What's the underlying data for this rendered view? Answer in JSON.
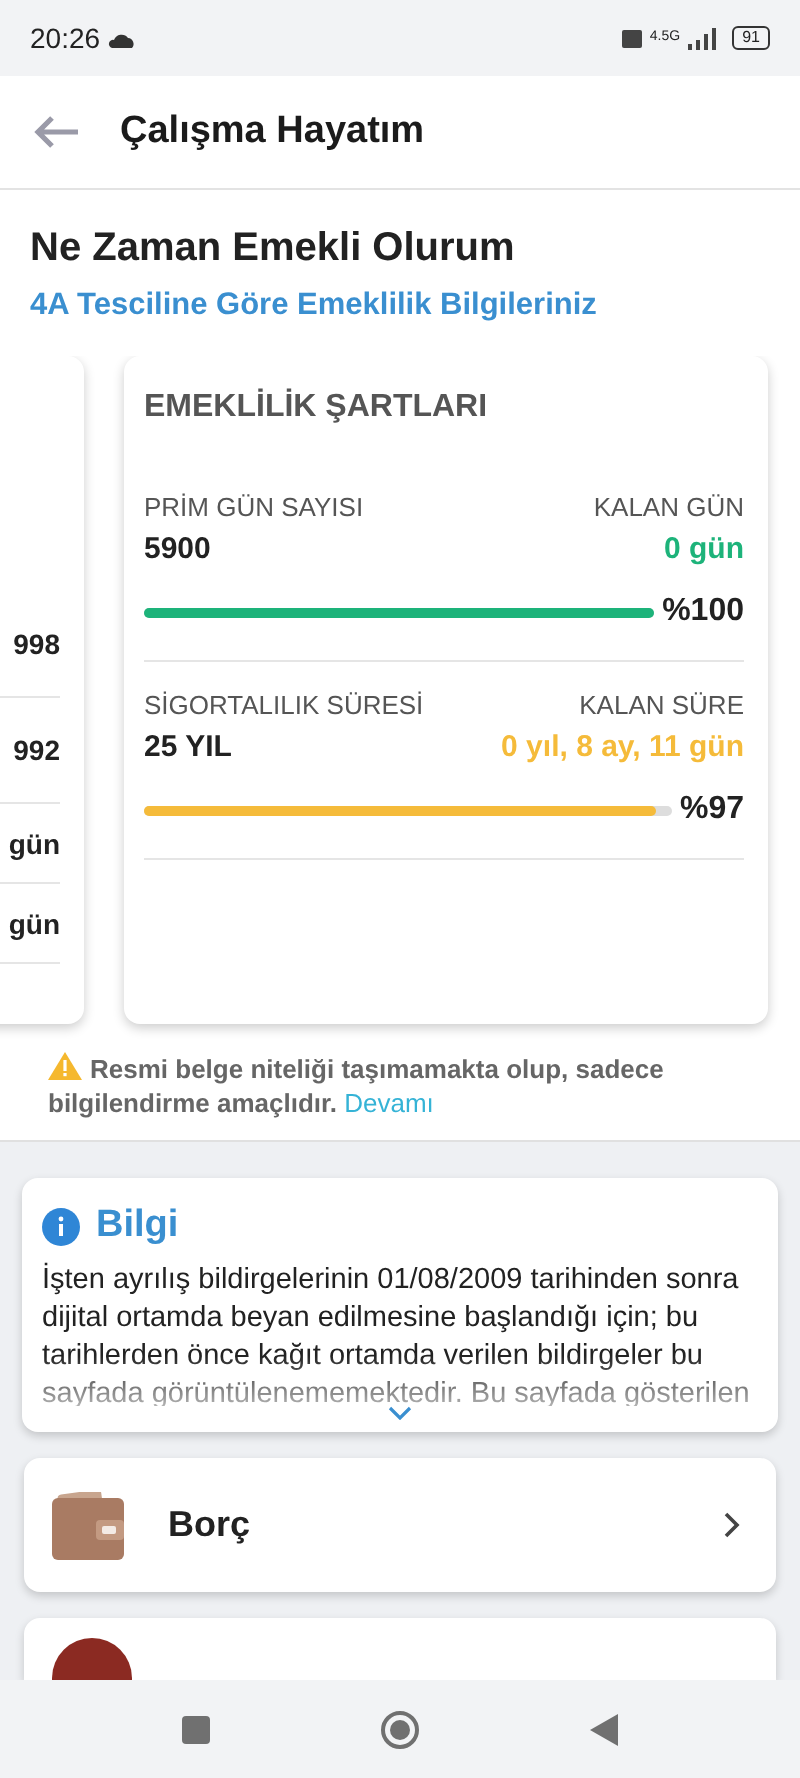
{
  "status_bar": {
    "time": "20:26",
    "battery": "91",
    "network": "4.5G"
  },
  "app_bar": {
    "title": "Çalışma Hayatım"
  },
  "heading": {
    "title": "Ne Zaman Emekli Olurum",
    "subtitle": "4A Tesciline Göre Emeklilik Bilgileriniz"
  },
  "previous_card": {
    "values": [
      "998",
      "992",
      "gün",
      "gün"
    ]
  },
  "conditions_card": {
    "title": "EMEKLİLİK ŞARTLARI",
    "items": [
      {
        "label": "PRİM GÜN SAYISI",
        "value": "5900",
        "remaining_label": "KALAN GÜN",
        "remaining": "0 gün",
        "color": "#1db37a",
        "level": 1.0,
        "percent": "%100"
      },
      {
        "label": "SİGORTALILIK SÜRESİ",
        "value": "25 YIL",
        "remaining_label": "KALAN SÜRE",
        "remaining": "0 yıl, 8 ay, 11 gün",
        "color": "#f5bb3a",
        "level": 0.97,
        "percent": "%97"
      }
    ]
  },
  "disclaimer": {
    "text": "Resmi belge niteliği taşımamakta olup, sadece bilgilendirme amaçlıdır.",
    "link": "Devamı"
  },
  "info_card": {
    "title": "Bilgi",
    "text": "İşten ayrılış bildirgelerinin 01/08/2009 tarihinden sonra dijital ortamda beyan edilmesine başlandığı için; bu tarihlerden önce kağıt ortamda verilen bildirgeler bu sayfada görüntülenememektedir. Bu sayfada gösterilen",
    "expanded": false
  },
  "menu": [
    {
      "kind": "wallet",
      "label": "Borç"
    },
    {
      "kind": "partial"
    }
  ]
}
